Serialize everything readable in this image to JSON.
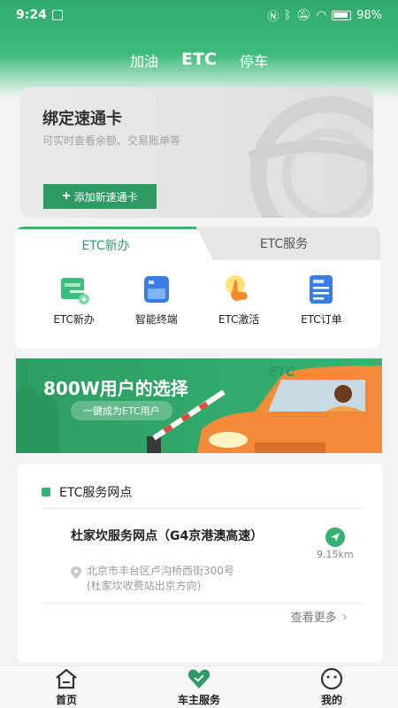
{
  "status_bar": {
    "time": "9:24",
    "battery": "98%"
  },
  "top_tabs": [
    {
      "label": "加油"
    },
    {
      "label": "ETC"
    },
    {
      "label": "停车"
    }
  ],
  "bind_card": {
    "title": "绑定速通卡",
    "subtitle": "可实时查看余额、交易账单等",
    "button": "添加新速通卡"
  },
  "etc_panel": {
    "tabs": [
      {
        "label": "ETC新办"
      },
      {
        "label": "ETC服务"
      }
    ],
    "items": [
      {
        "label": "ETC新办",
        "icon": "new-card-icon"
      },
      {
        "label": "智能终端",
        "icon": "device-icon"
      },
      {
        "label": "ETC激活",
        "icon": "activate-icon"
      },
      {
        "label": "ETC订单",
        "icon": "order-icon"
      }
    ]
  },
  "banner": {
    "title": "800W用户的选择",
    "pill": "一键成为ETC用户",
    "car_sign": "ETC"
  },
  "outlets": {
    "header": "ETC服务网点",
    "name": "杜家坎服务网点（G4京港澳高速）",
    "distance": "9.15km",
    "address_line1": "北京市丰台区卢沟桥西街300号",
    "address_line2": "(杜家坎收费站出京方向)",
    "see_more": "查看更多"
  },
  "bottom_nav": [
    {
      "label": "首页",
      "icon": "home-icon"
    },
    {
      "label": "车主服务",
      "icon": "heart-icon"
    },
    {
      "label": "我的",
      "icon": "profile-icon"
    }
  ],
  "colors": {
    "brand": "#2f9a63",
    "accent": "#39b573"
  }
}
